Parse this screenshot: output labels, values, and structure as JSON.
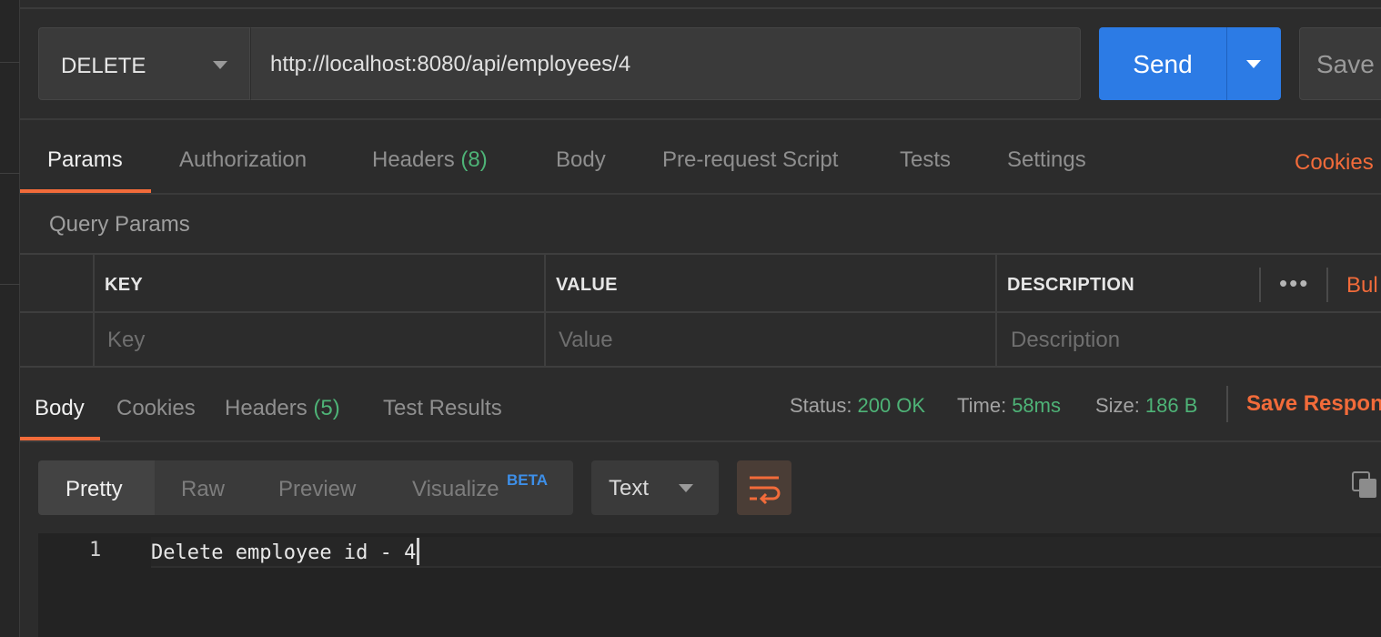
{
  "request": {
    "method": "DELETE",
    "url": "http://localhost:8080/api/employees/4",
    "send_label": "Send",
    "save_label": "Save"
  },
  "request_tabs": {
    "params": "Params",
    "authorization": "Authorization",
    "headers": "Headers",
    "headers_count": "(8)",
    "body": "Body",
    "pre_request": "Pre-request Script",
    "tests": "Tests",
    "settings": "Settings",
    "cookies": "Cookies"
  },
  "query_params": {
    "title": "Query Params",
    "columns": {
      "key": "KEY",
      "value": "VALUE",
      "description": "DESCRIPTION"
    },
    "more": "•••",
    "bulk_edit": "Bul",
    "placeholders": {
      "key": "Key",
      "value": "Value",
      "description": "Description"
    }
  },
  "response_tabs": {
    "body": "Body",
    "cookies": "Cookies",
    "headers": "Headers",
    "headers_count": "(5)",
    "test_results": "Test Results"
  },
  "status": {
    "status_label": "Status:",
    "status_value": "200 OK",
    "time_label": "Time:",
    "time_value": "58ms",
    "size_label": "Size:",
    "size_value": "186 B",
    "save_response": "Save Respons"
  },
  "view_modes": {
    "pretty": "Pretty",
    "raw": "Raw",
    "preview": "Preview",
    "visualize": "Visualize",
    "beta": "BETA"
  },
  "format": {
    "selected": "Text"
  },
  "icons": {
    "wrap": "wrap-lines-icon",
    "copy": "copy-icon",
    "caret": "chevron-down-icon"
  },
  "colors": {
    "accent": "#f26b3a",
    "send": "#2c7be5",
    "success": "#4eb377",
    "background": "#2c2c2c"
  },
  "code": {
    "line_number": "1",
    "text": "Delete employee id - 4"
  }
}
